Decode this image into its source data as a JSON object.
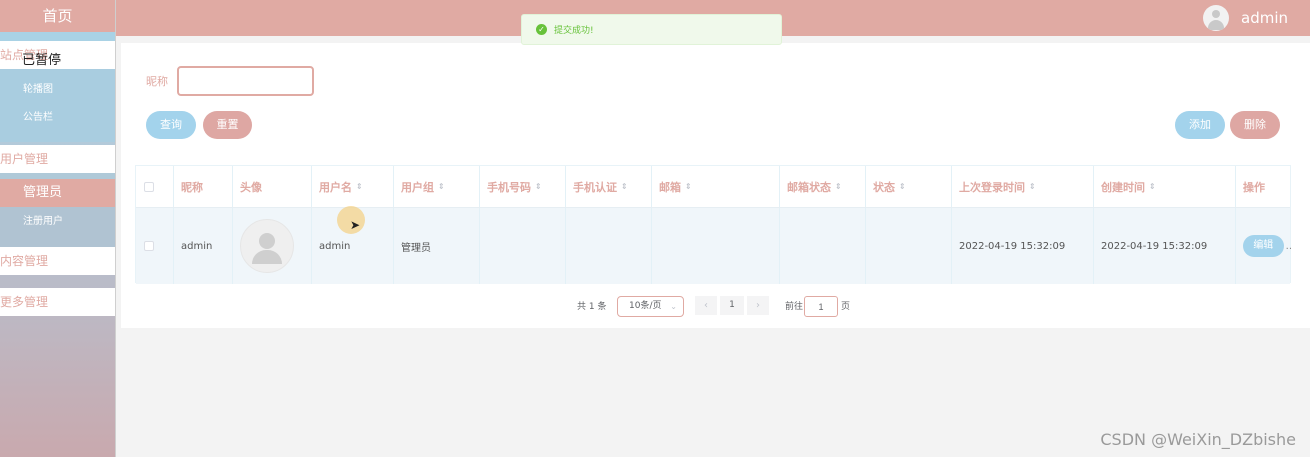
{
  "header": {
    "username": "admin",
    "avatar_icon": "user-avatar-icon"
  },
  "sidebar": {
    "home": "首页",
    "groups": [
      {
        "label": "站点管理",
        "overlap_text": "已暂停"
      },
      {
        "label": "用户管理"
      },
      {
        "label": "内容管理"
      },
      {
        "label": "更多管理"
      }
    ],
    "site_items": [
      "轮播图",
      "公告栏"
    ],
    "user_items": [
      "管理员",
      "注册用户"
    ],
    "active_item": "管理员"
  },
  "search": {
    "label": "昵称",
    "value": "",
    "placeholder": ""
  },
  "buttons": {
    "query": "查询",
    "reset": "重置",
    "add": "添加",
    "delete": "删除"
  },
  "table": {
    "headers": [
      "昵称",
      "头像",
      "用户名",
      "用户组",
      "手机号码",
      "手机认证",
      "邮箱",
      "邮箱状态",
      "状态",
      "上次登录时间",
      "创建时间",
      "操作"
    ],
    "rows": [
      {
        "nickname": "admin",
        "username": "admin",
        "group": "管理员",
        "phone": "",
        "phone_verified": "",
        "email": "",
        "email_status": "",
        "status": "",
        "last_login": "2022-04-19 15:32:09",
        "created": "2022-04-19 15:32:09",
        "edit": "编辑",
        "more": ".."
      }
    ]
  },
  "pagination": {
    "total": "共 1 条",
    "page_size": "10条/页",
    "prev": "‹",
    "current_page": "1",
    "next": "›",
    "goto_label": "前往",
    "goto_value": "1",
    "page_suffix": "页"
  },
  "toast": {
    "message": "提交成功!",
    "icon": "success-check-icon",
    "color": "#67c23a"
  },
  "watermark": "CSDN @WeiXin_DZbishe",
  "colors": {
    "accent_pink": "#e0aaa3",
    "accent_blue": "#a3d3ec"
  }
}
